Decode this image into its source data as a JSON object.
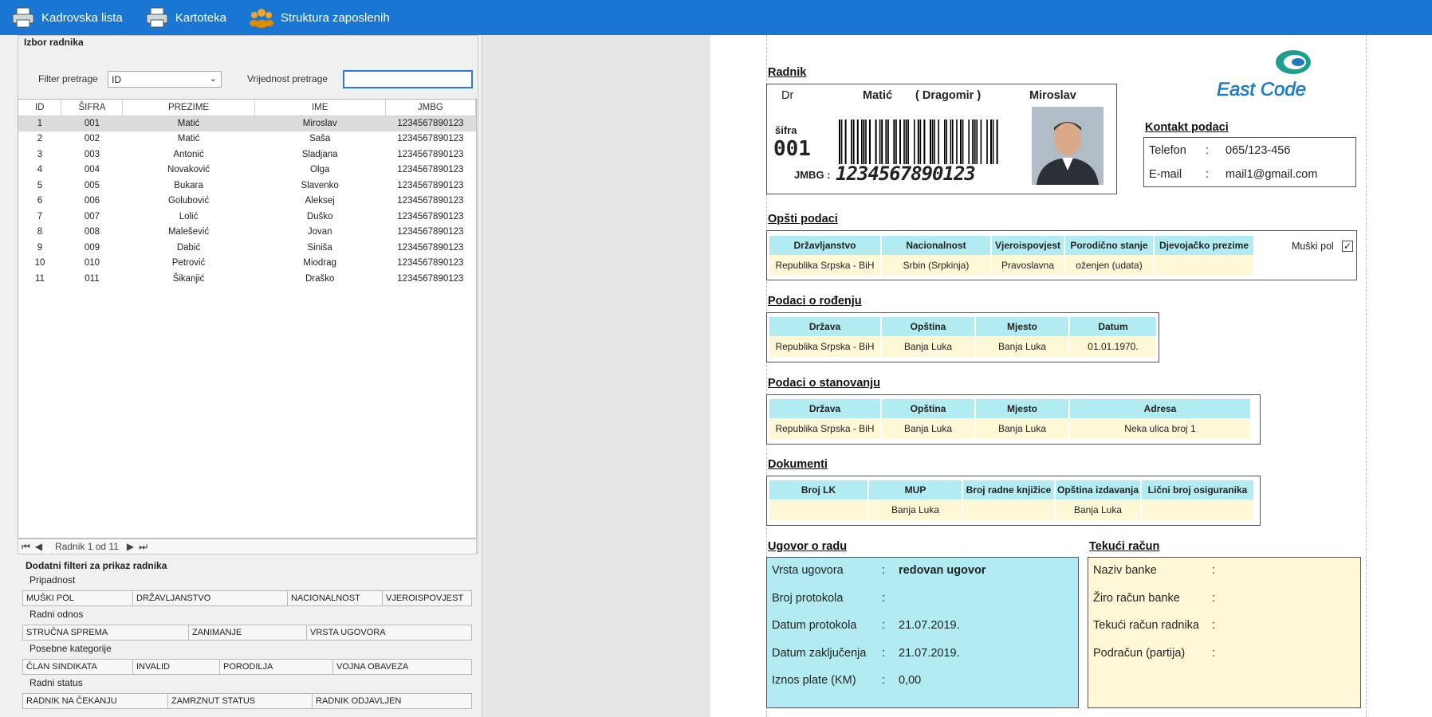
{
  "toolbar": {
    "b1": "Kadrovska lista",
    "b2": "Kartoteka",
    "b3": "Struktura zaposlenih"
  },
  "left": {
    "group_title": "Izbor radnika",
    "filter_label": "Filter pretrage",
    "filter_value": "ID",
    "value_label": "Vrijednost pretrage",
    "columns": [
      "ID",
      "ŠIFRA",
      "PREZIME",
      "IME",
      "JMBG"
    ],
    "rows": [
      [
        "1",
        "001",
        "Matić",
        "Miroslav",
        "1234567890123"
      ],
      [
        "2",
        "002",
        "Matić",
        "Saša",
        "1234567890123"
      ],
      [
        "3",
        "003",
        "Antonić",
        "Sladjana",
        "1234567890123"
      ],
      [
        "4",
        "004",
        "Novaković",
        "Olga",
        "1234567890123"
      ],
      [
        "5",
        "005",
        "Bukara",
        "Slavenko",
        "1234567890123"
      ],
      [
        "6",
        "006",
        "Golubović",
        "Aleksej",
        "1234567890123"
      ],
      [
        "7",
        "007",
        "Lolić",
        "Duško",
        "1234567890123"
      ],
      [
        "8",
        "008",
        "Malešević",
        "Jovan",
        "1234567890123"
      ],
      [
        "9",
        "009",
        "Dabić",
        "Siniša",
        "1234567890123"
      ],
      [
        "10",
        "010",
        "Petrović",
        "Miodrag",
        "1234567890123"
      ],
      [
        "11",
        "011",
        "Šikanjić",
        "Draško",
        "1234567890123"
      ]
    ],
    "nav_text": "Radnik 1 od 11",
    "filters_title": "Dodatni filteri za prikaz radnika",
    "sections": [
      {
        "title": "Pripadnost",
        "items": [
          "MUŠKI POL",
          "DRŽAVLJANSTVO",
          "NACIONALNOST",
          "VJEROISPOVJEST"
        ]
      },
      {
        "title": "Radni odnos",
        "items": [
          "STRUČNA SPREMA",
          "ZANIMANJE",
          "VRSTA UGOVORA"
        ]
      },
      {
        "title": "Posebne kategorije",
        "items": [
          "ČLAN SINDIKATA",
          "INVALID",
          "PORODILJA",
          "VOJNA OBAVEZA"
        ]
      },
      {
        "title": "Radni status",
        "items": [
          "RADNIK NA ČEKANJU",
          "ZAMRZNUT STATUS",
          "RADNIK ODJAVLJEN"
        ]
      }
    ]
  },
  "report": {
    "radnik_hdr": "Radnik",
    "title": "Dr",
    "prezime": "Matić",
    "otac": "( Dragomir )",
    "ime": "Miroslav",
    "sifra_label": "šifra",
    "sifra": "001",
    "jmbg_label": "JMBG :",
    "jmbg": "1234567890123",
    "logo": "East Code",
    "kontakt_hdr": "Kontakt podaci",
    "tel_label": "Telefon",
    "tel": "065/123-456",
    "mail_label": "E-mail",
    "mail": "mail1@gmail.com",
    "opsti_hdr": "Opšti podaci",
    "opsti_cols": [
      "Državljanstvo",
      "Nacionalnost",
      "Vjeroispovjest",
      "Porodično stanje",
      "Djevojačko prezime"
    ],
    "opsti_vals": [
      "Republika Srpska - BiH",
      "Srbin (Srpkinja)",
      "Pravoslavna",
      "oženjen (udata)",
      ""
    ],
    "muski": "Muški pol",
    "rodj_hdr": "Podaci o rođenju",
    "rodj_cols": [
      "Država",
      "Opština",
      "Mjesto",
      "Datum"
    ],
    "rodj_vals": [
      "Republika Srpska - BiH",
      "Banja Luka",
      "Banja Luka",
      "01.01.1970."
    ],
    "stan_hdr": "Podaci o stanovanju",
    "stan_cols": [
      "Država",
      "Opština",
      "Mjesto",
      "Adresa"
    ],
    "stan_vals": [
      "Republika Srpska - BiH",
      "Banja Luka",
      "Banja Luka",
      "Neka ulica broj 1"
    ],
    "dok_hdr": "Dokumenti",
    "dok_cols": [
      "Broj LK",
      "MUP",
      "Broj radne knjižice",
      "Opština izdavanja",
      "Lični broj osiguranika"
    ],
    "dok_vals": [
      "",
      "Banja Luka",
      "",
      "Banja Luka",
      ""
    ],
    "ugovor_hdr": "Ugovor o radu",
    "ugovor": [
      [
        "Vrsta ugovora",
        ":",
        "redovan ugovor"
      ],
      [
        "Broj protokola",
        ":",
        ""
      ],
      [
        "Datum protokola",
        ":",
        "21.07.2019."
      ],
      [
        "Datum zaključenja",
        ":",
        "21.07.2019."
      ],
      [
        "Iznos plate (KM)",
        ":",
        "0,00"
      ]
    ],
    "racun_hdr": "Tekući račun",
    "racun": [
      [
        "Naziv banke",
        ":"
      ],
      [
        "Žiro račun banke",
        ":"
      ],
      [
        "Tekući račun radnika",
        ":"
      ],
      [
        "Podračun (partija)",
        ":"
      ]
    ]
  },
  "colors": {
    "toolbar": "#1976d2",
    "cyan": "#b2ebf2",
    "cream": "#fff8d6",
    "logo_green": "#1e9e8c",
    "logo_blue": "#1f78c8"
  }
}
